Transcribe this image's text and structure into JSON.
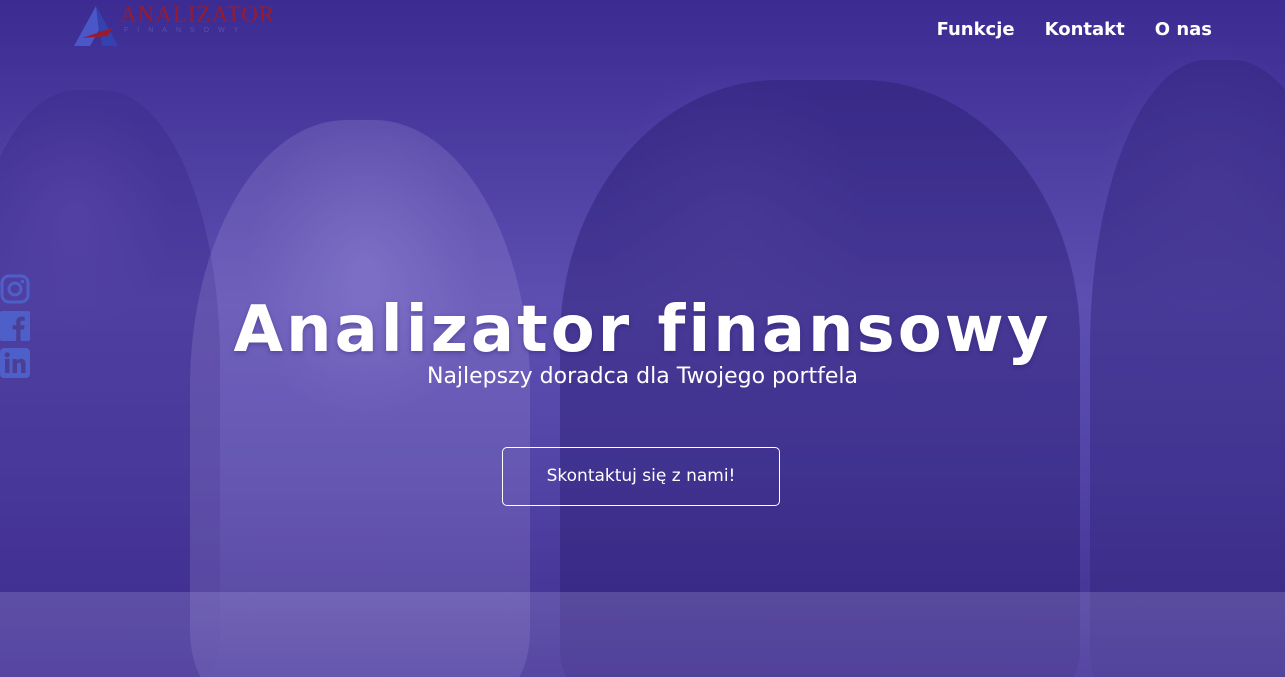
{
  "brand": {
    "name": "ANALIZATOR",
    "tagline": "FINANSOWY",
    "accent_color": "#9b1b2a",
    "mark_color": "#4a57c8"
  },
  "nav": {
    "items": [
      {
        "label": "Funkcje"
      },
      {
        "label": "Kontakt"
      },
      {
        "label": "O nas"
      }
    ]
  },
  "social": {
    "items": [
      {
        "icon": "instagram-icon"
      },
      {
        "icon": "facebook-icon"
      },
      {
        "icon": "linkedin-icon"
      }
    ],
    "color": "#4f5fc9"
  },
  "hero": {
    "title": "Analizator finansowy",
    "subtitle": "Najlepszy doradca dla Twojego portfela",
    "cta_label": "Skontaktuj się z nami!",
    "overlay_color": "#4a3f95"
  }
}
